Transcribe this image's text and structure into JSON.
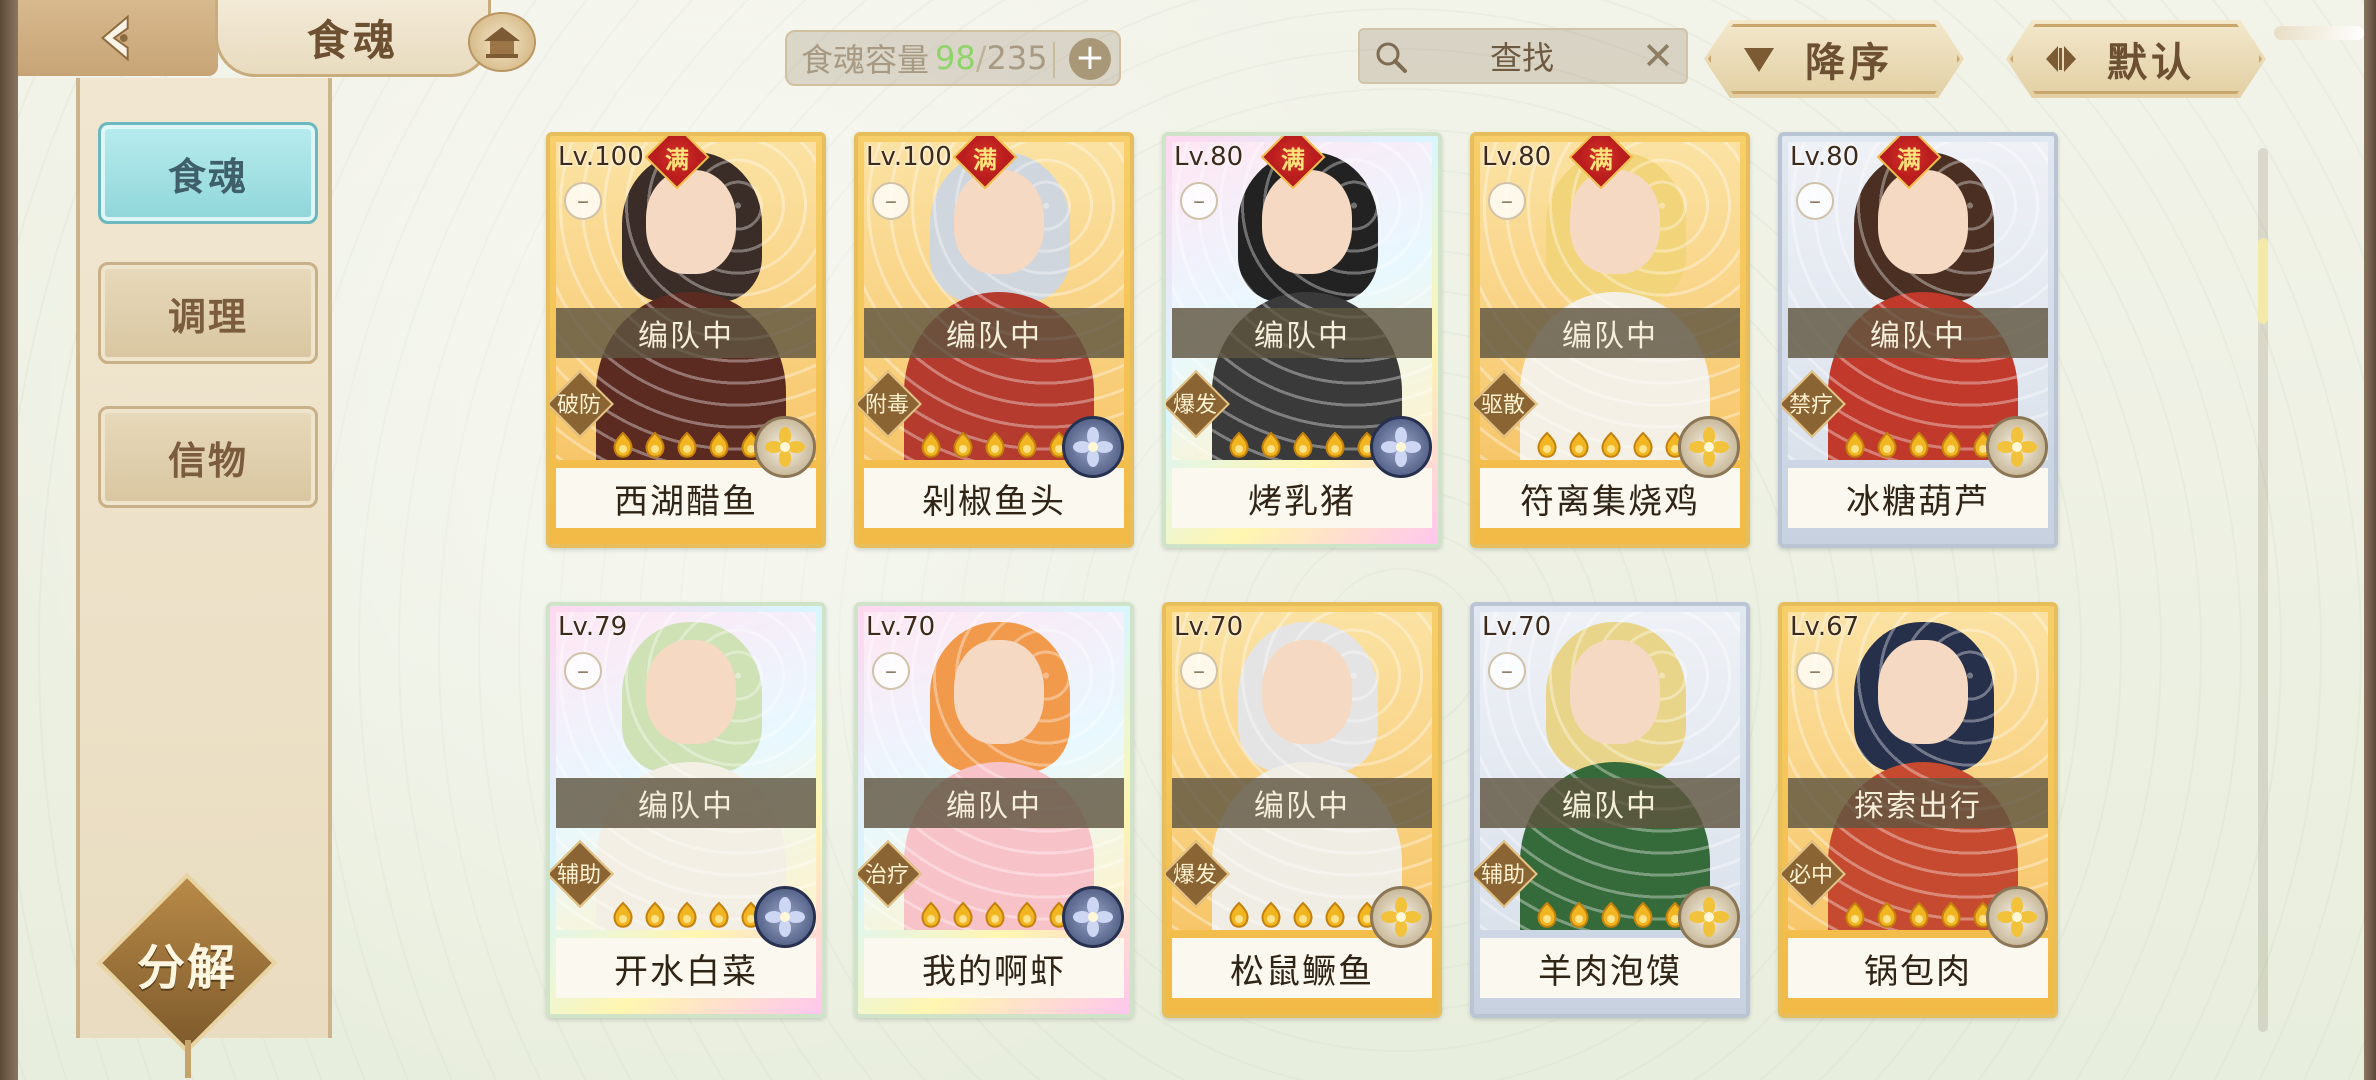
{
  "header": {
    "title": "食魂",
    "capacity": {
      "label": "食魂容量",
      "current": "98",
      "separator": "/",
      "max": "235",
      "add_label": "+"
    },
    "search": {
      "placeholder": "查找",
      "clear_label": "✕"
    },
    "sort_order_label": "降序",
    "sort_default_label": "默认"
  },
  "sidebar": {
    "tabs": [
      {
        "label": "食魂",
        "active": true
      },
      {
        "label": "调理",
        "active": false
      },
      {
        "label": "信物",
        "active": false
      }
    ],
    "decompose_label": "分解"
  },
  "cards": [
    {
      "level": "Lv.100",
      "full": "满",
      "status": "编队中",
      "role": "破防",
      "name": "西湖醋鱼",
      "stars": 6,
      "element": "light",
      "frame": "gold"
    },
    {
      "level": "Lv.100",
      "full": "满",
      "status": "编队中",
      "role": "附毒",
      "name": "剁椒鱼头",
      "stars": 6,
      "element": "dark",
      "frame": "gold"
    },
    {
      "level": "Lv.80",
      "full": "满",
      "status": "编队中",
      "role": "爆发",
      "name": "烤乳猪",
      "stars": 5,
      "element": "dark",
      "frame": "rainbow"
    },
    {
      "level": "Lv.80",
      "full": "满",
      "status": "编队中",
      "role": "驱散",
      "name": "符离集烧鸡",
      "stars": 5,
      "element": "light",
      "frame": "gold"
    },
    {
      "level": "Lv.80",
      "full": "满",
      "status": "编队中",
      "role": "禁疗",
      "name": "冰糖葫芦",
      "stars": 5,
      "element": "light",
      "frame": "silver"
    },
    {
      "level": "Lv.79",
      "full": "",
      "status": "编队中",
      "role": "辅助",
      "name": "开水白菜",
      "stars": 5,
      "element": "dark",
      "frame": "rainbow"
    },
    {
      "level": "Lv.70",
      "full": "",
      "status": "编队中",
      "role": "治疗",
      "name": "我的啊虾",
      "stars": 6,
      "element": "dark",
      "frame": "rainbow"
    },
    {
      "level": "Lv.70",
      "full": "",
      "status": "编队中",
      "role": "爆发",
      "name": "松鼠鳜鱼",
      "stars": 5,
      "element": "light",
      "frame": "gold"
    },
    {
      "level": "Lv.70",
      "full": "",
      "status": "编队中",
      "role": "辅助",
      "name": "羊肉泡馍",
      "stars": 5,
      "element": "light",
      "frame": "silver"
    },
    {
      "level": "Lv.67",
      "full": "",
      "status": "探索出行",
      "role": "必中",
      "name": "锅包肉",
      "stars": 5,
      "element": "light",
      "frame": "gold"
    }
  ],
  "icons": {
    "back": "back-arrow-icon",
    "home": "home-icon",
    "search": "search-icon",
    "sort": "sort-down-icon",
    "default": "swap-icon"
  },
  "colors": {
    "accent_teal": "#8fd6d9",
    "capacity_current": "#8fd46a",
    "full_badge": "#b91d1d",
    "frame_gold": "#f2b945"
  }
}
